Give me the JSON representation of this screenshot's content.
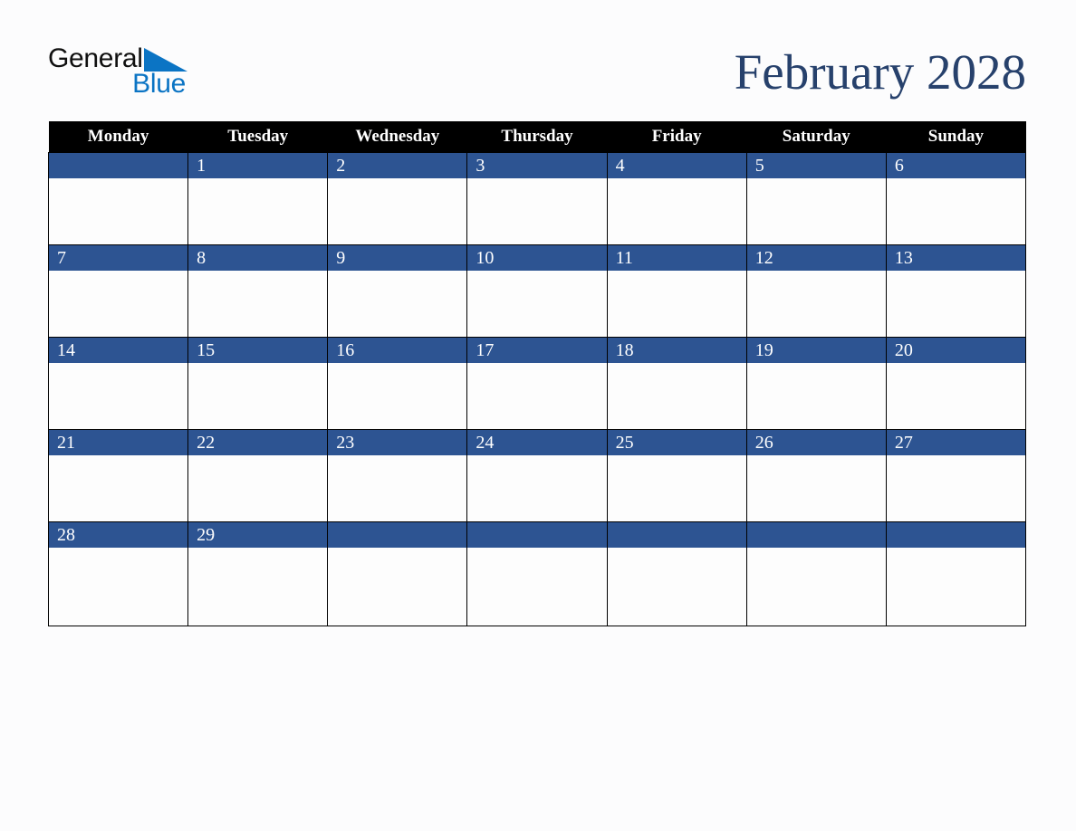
{
  "brand": {
    "name_part1": "General",
    "name_part2": "Blue",
    "triangle_color": "#0b74c4",
    "text_color_primary": "#101010",
    "text_color_secondary": "#0b74c4"
  },
  "header": {
    "title": "February 2028",
    "title_color": "#27416c"
  },
  "calendar": {
    "month": "February",
    "year": "2028",
    "header_bg": "#000000",
    "header_fg": "#ffffff",
    "daynum_bg": "#2d5492",
    "daynum_fg": "#ffffff",
    "cell_bg": "#fdfdfd",
    "border_color": "#000000",
    "weekday_headers": [
      "Monday",
      "Tuesday",
      "Wednesday",
      "Thursday",
      "Friday",
      "Saturday",
      "Sunday"
    ],
    "weeks": [
      [
        "",
        "1",
        "2",
        "3",
        "4",
        "5",
        "6"
      ],
      [
        "7",
        "8",
        "9",
        "10",
        "11",
        "12",
        "13"
      ],
      [
        "14",
        "15",
        "16",
        "17",
        "18",
        "19",
        "20"
      ],
      [
        "21",
        "22",
        "23",
        "24",
        "25",
        "26",
        "27"
      ],
      [
        "28",
        "29",
        "",
        "",
        "",
        "",
        ""
      ]
    ]
  }
}
